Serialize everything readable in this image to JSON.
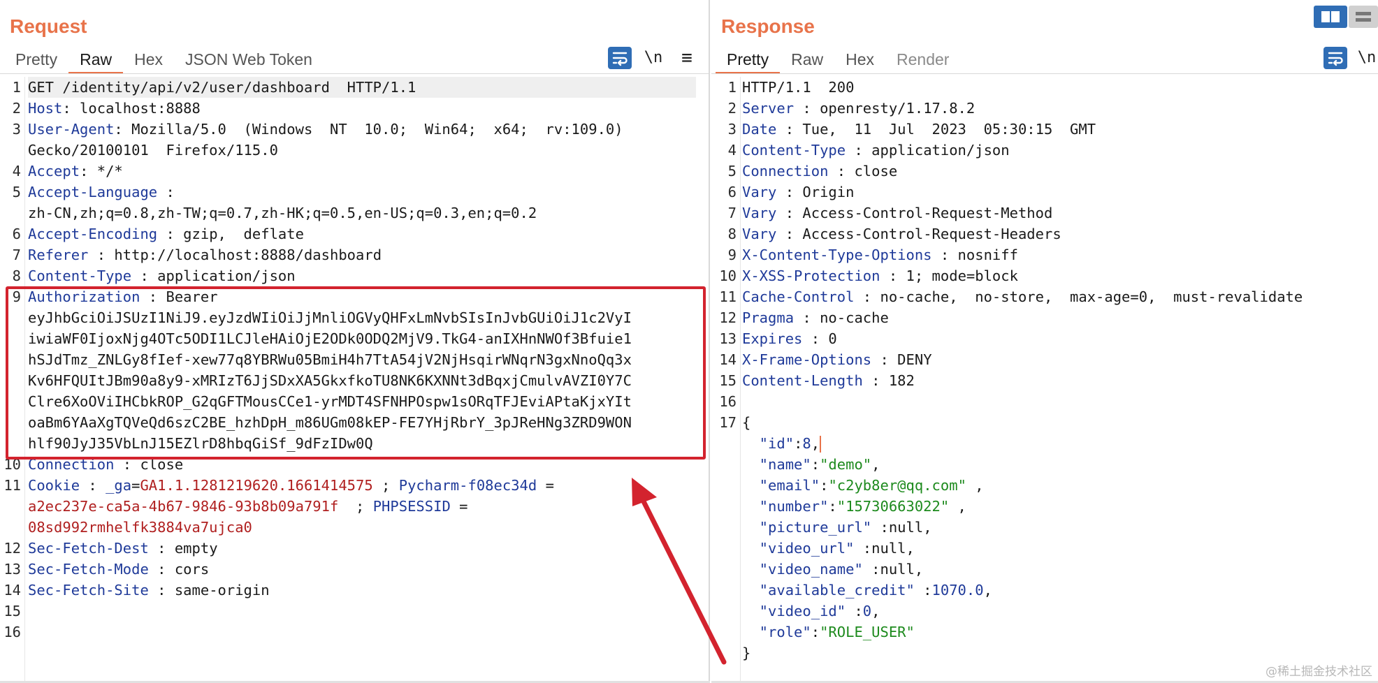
{
  "request": {
    "title": "Request",
    "tabs": [
      {
        "label": "Pretty",
        "active": false
      },
      {
        "label": "Raw",
        "active": true
      },
      {
        "label": "Hex",
        "active": false
      },
      {
        "label": "JSON Web Token",
        "active": false
      }
    ],
    "tools": {
      "newline": "\\n",
      "menu": "≡"
    },
    "lines": [
      {
        "n": "1",
        "rows": [
          [
            {
              "t": "GET /identity/api/v2/user/dashboard  HTTP/1.1",
              "c": "v"
            }
          ]
        ]
      },
      {
        "n": "2",
        "rows": [
          [
            {
              "t": "Host",
              "c": "k"
            },
            {
              "t": ": localhost:8888",
              "c": "v"
            }
          ]
        ]
      },
      {
        "n": "3",
        "rows": [
          [
            {
              "t": "User-Agent",
              "c": "k"
            },
            {
              "t": ": Mozilla/5.0  (Windows  NT  10.0;  Win64;  x64;  rv:109.0)",
              "c": "v"
            }
          ],
          [
            {
              "t": "Gecko/20100101  Firefox/115.0",
              "c": "v"
            }
          ]
        ]
      },
      {
        "n": "4",
        "rows": [
          [
            {
              "t": "Accept",
              "c": "k"
            },
            {
              "t": ": */*",
              "c": "v"
            }
          ]
        ]
      },
      {
        "n": "5",
        "rows": [
          [
            {
              "t": "Accept-Language",
              "c": "k"
            },
            {
              "t": " :",
              "c": "v"
            }
          ],
          [
            {
              "t": "zh-CN,zh;q=0.8,zh-TW;q=0.7,zh-HK;q=0.5,en-US;q=0.3,en;q=0.2",
              "c": "v"
            }
          ]
        ]
      },
      {
        "n": "6",
        "rows": [
          [
            {
              "t": "Accept-Encoding",
              "c": "k"
            },
            {
              "t": " : gzip,  deflate",
              "c": "v"
            }
          ]
        ]
      },
      {
        "n": "7",
        "rows": [
          [
            {
              "t": "Referer",
              "c": "k"
            },
            {
              "t": " : http://localhost:8888/dashboard",
              "c": "v"
            }
          ]
        ]
      },
      {
        "n": "8",
        "rows": [
          [
            {
              "t": "Content-Type",
              "c": "k"
            },
            {
              "t": " : application/json",
              "c": "v"
            }
          ]
        ]
      },
      {
        "n": "9",
        "rows": [
          [
            {
              "t": "Authorization",
              "c": "k"
            },
            {
              "t": " : Bearer",
              "c": "v"
            }
          ],
          [
            {
              "t": "eyJhbGciOiJSUzI1NiJ9.eyJzdWIiOiJjMnliOGVyQHFxLmNvbSIsInJvbGUiOiJ1c2VyI",
              "c": "v"
            }
          ],
          [
            {
              "t": "iwiaWF0IjoxNjg4OTc5ODI1LCJleHAiOjE2ODk0ODQ2MjV9.TkG4-anIXHnNWOf3Bfuie1",
              "c": "v"
            }
          ],
          [
            {
              "t": "hSJdTmz_ZNLGy8fIef-xew77q8YBRWu05BmiH4h7TtA54jV2NjHsqirWNqrN3gxNnoQq3x",
              "c": "v"
            }
          ],
          [
            {
              "t": "Kv6HFQUItJBm90a8y9-xMRIzT6JjSDxXA5GkxfkoTU8NK6KXNNt3dBqxjCmulvAVZI0Y7C",
              "c": "v"
            }
          ],
          [
            {
              "t": "Clre6XoOViIHCbkROP_G2qGFTMousCCe1-yrMDT4SFNHPOspw1sORqTFJEviAPtaKjxYIt",
              "c": "v"
            }
          ],
          [
            {
              "t": "oaBm6YAaXgTQVeQd6szC2BE_hzhDpH_m86UGm08kEP-FE7YHjRbrY_3pJReHNg3ZRD9WON",
              "c": "v"
            }
          ],
          [
            {
              "t": "hlf90JyJ35VbLnJ15EZlrD8hbqGiSf_9dFzIDw0Q",
              "c": "v"
            }
          ]
        ]
      },
      {
        "n": "10",
        "rows": [
          [
            {
              "t": "Connection",
              "c": "k"
            },
            {
              "t": " : close",
              "c": "v"
            }
          ]
        ]
      },
      {
        "n": "11",
        "rows": [
          [
            {
              "t": "Cookie",
              "c": "k"
            },
            {
              "t": " : ",
              "c": "v"
            },
            {
              "t": "_ga",
              "c": "k"
            },
            {
              "t": "=",
              "c": "v"
            },
            {
              "t": "GA1.1.1281219620.1661414575",
              "c": "cv"
            },
            {
              "t": " ; ",
              "c": "v"
            },
            {
              "t": "Pycharm-f08ec34d",
              "c": "k"
            },
            {
              "t": " =",
              "c": "v"
            }
          ],
          [
            {
              "t": "a2ec237e-ca5a-4b67-9846-93b8b09a791f",
              "c": "cv"
            },
            {
              "t": "  ; ",
              "c": "v"
            },
            {
              "t": "PHPSESSID",
              "c": "k"
            },
            {
              "t": " =",
              "c": "v"
            }
          ],
          [
            {
              "t": "08sd992rmhelfk3884va7ujca0",
              "c": "cv"
            }
          ]
        ]
      },
      {
        "n": "12",
        "rows": [
          [
            {
              "t": "Sec-Fetch-Dest",
              "c": "k"
            },
            {
              "t": " : empty",
              "c": "v"
            }
          ]
        ]
      },
      {
        "n": "13",
        "rows": [
          [
            {
              "t": "Sec-Fetch-Mode",
              "c": "k"
            },
            {
              "t": " : cors",
              "c": "v"
            }
          ]
        ]
      },
      {
        "n": "14",
        "rows": [
          [
            {
              "t": "Sec-Fetch-Site",
              "c": "k"
            },
            {
              "t": " : same-origin",
              "c": "v"
            }
          ]
        ]
      },
      {
        "n": "15",
        "rows": [
          [
            {
              "t": "",
              "c": "v"
            }
          ]
        ]
      },
      {
        "n": "16",
        "rows": [
          [
            {
              "t": "",
              "c": "v"
            }
          ]
        ]
      }
    ]
  },
  "response": {
    "title": "Response",
    "tabs": [
      {
        "label": "Pretty",
        "active": true
      },
      {
        "label": "Raw",
        "active": false
      },
      {
        "label": "Hex",
        "active": false
      },
      {
        "label": "Render",
        "active": false,
        "disabled": true
      }
    ],
    "tools": {
      "newline": "\\n"
    },
    "lines": [
      {
        "n": "1",
        "rows": [
          [
            {
              "t": "HTTP/1.1  200",
              "c": "v"
            }
          ]
        ]
      },
      {
        "n": "2",
        "rows": [
          [
            {
              "t": "Server",
              "c": "k"
            },
            {
              "t": " : openresty/1.17.8.2",
              "c": "v"
            }
          ]
        ]
      },
      {
        "n": "3",
        "rows": [
          [
            {
              "t": "Date",
              "c": "k"
            },
            {
              "t": " : Tue,  11  Jul  2023  05:30:15  GMT",
              "c": "v"
            }
          ]
        ]
      },
      {
        "n": "4",
        "rows": [
          [
            {
              "t": "Content-Type",
              "c": "k"
            },
            {
              "t": " : application/json",
              "c": "v"
            }
          ]
        ]
      },
      {
        "n": "5",
        "rows": [
          [
            {
              "t": "Connection",
              "c": "k"
            },
            {
              "t": " : close",
              "c": "v"
            }
          ]
        ]
      },
      {
        "n": "6",
        "rows": [
          [
            {
              "t": "Vary",
              "c": "k"
            },
            {
              "t": " : Origin",
              "c": "v"
            }
          ]
        ]
      },
      {
        "n": "7",
        "rows": [
          [
            {
              "t": "Vary",
              "c": "k"
            },
            {
              "t": " : Access-Control-Request-Method",
              "c": "v"
            }
          ]
        ]
      },
      {
        "n": "8",
        "rows": [
          [
            {
              "t": "Vary",
              "c": "k"
            },
            {
              "t": " : Access-Control-Request-Headers",
              "c": "v"
            }
          ]
        ]
      },
      {
        "n": "9",
        "rows": [
          [
            {
              "t": "X-Content-Type-Options",
              "c": "k"
            },
            {
              "t": " : nosniff",
              "c": "v"
            }
          ]
        ]
      },
      {
        "n": "10",
        "rows": [
          [
            {
              "t": "X-XSS-Protection",
              "c": "k"
            },
            {
              "t": " : 1; mode=block",
              "c": "v"
            }
          ]
        ]
      },
      {
        "n": "11",
        "rows": [
          [
            {
              "t": "Cache-Control",
              "c": "k"
            },
            {
              "t": " : no-cache,  no-store,  max-age=0,  must-revalidate",
              "c": "v"
            }
          ]
        ]
      },
      {
        "n": "12",
        "rows": [
          [
            {
              "t": "Pragma",
              "c": "k"
            },
            {
              "t": " : no-cache",
              "c": "v"
            }
          ]
        ]
      },
      {
        "n": "13",
        "rows": [
          [
            {
              "t": "Expires",
              "c": "k"
            },
            {
              "t": " : 0",
              "c": "v"
            }
          ]
        ]
      },
      {
        "n": "14",
        "rows": [
          [
            {
              "t": "X-Frame-Options",
              "c": "k"
            },
            {
              "t": " : DENY",
              "c": "v"
            }
          ]
        ]
      },
      {
        "n": "15",
        "rows": [
          [
            {
              "t": "Content-Length",
              "c": "k"
            },
            {
              "t": " : 182",
              "c": "v"
            }
          ]
        ]
      },
      {
        "n": "16",
        "rows": [
          [
            {
              "t": "",
              "c": "v"
            }
          ]
        ]
      },
      {
        "n": "17",
        "rows": [
          [
            {
              "t": "{",
              "c": "v"
            }
          ],
          [
            {
              "t": "  \"id\"",
              "c": "jk"
            },
            {
              "t": ":",
              "c": "v"
            },
            {
              "t": "8",
              "c": "jn"
            },
            {
              "t": ",",
              "c": "v"
            },
            {
              "t": "",
              "c": "cursor"
            }
          ],
          [
            {
              "t": "  \"name\"",
              "c": "jk"
            },
            {
              "t": ":",
              "c": "v"
            },
            {
              "t": "\"demo\"",
              "c": "js"
            },
            {
              "t": ",",
              "c": "v"
            }
          ],
          [
            {
              "t": "  \"email\"",
              "c": "jk"
            },
            {
              "t": ":",
              "c": "v"
            },
            {
              "t": "\"c2yb8er@qq.com\"",
              "c": "js"
            },
            {
              "t": " ,",
              "c": "v"
            }
          ],
          [
            {
              "t": "  \"number\"",
              "c": "jk"
            },
            {
              "t": ":",
              "c": "v"
            },
            {
              "t": "\"15730663022\"",
              "c": "js"
            },
            {
              "t": " ,",
              "c": "v"
            }
          ],
          [
            {
              "t": "  \"picture_url\"",
              "c": "jk"
            },
            {
              "t": " :null,",
              "c": "v"
            }
          ],
          [
            {
              "t": "  \"video_url\"",
              "c": "jk"
            },
            {
              "t": " :null,",
              "c": "v"
            }
          ],
          [
            {
              "t": "  \"video_name\"",
              "c": "jk"
            },
            {
              "t": " :null,",
              "c": "v"
            }
          ],
          [
            {
              "t": "  \"available_credit\"",
              "c": "jk"
            },
            {
              "t": " :",
              "c": "v"
            },
            {
              "t": "1070.0",
              "c": "jn"
            },
            {
              "t": ",",
              "c": "v"
            }
          ],
          [
            {
              "t": "  \"video_id\"",
              "c": "jk"
            },
            {
              "t": " :",
              "c": "v"
            },
            {
              "t": "0",
              "c": "jn"
            },
            {
              "t": ",",
              "c": "v"
            }
          ],
          [
            {
              "t": "  \"role\"",
              "c": "jk"
            },
            {
              "t": ":",
              "c": "v"
            },
            {
              "t": "\"ROLE_USER\"",
              "c": "js"
            }
          ],
          [
            {
              "t": "}",
              "c": "v"
            }
          ]
        ]
      }
    ]
  },
  "watermark": "@稀土掘金技术社区",
  "colors": {
    "accent": "#e8734a",
    "key": "#1f3a99",
    "cookie_value": "#b02020",
    "json_string": "#1d8a1d",
    "highlight_box": "#d3232e",
    "tool_blue": "#2f6db5"
  }
}
